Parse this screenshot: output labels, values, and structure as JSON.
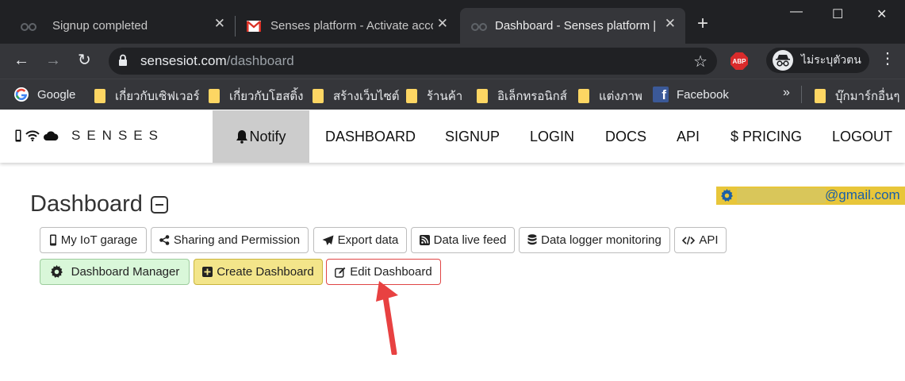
{
  "browser": {
    "tabs": [
      {
        "title": "Signup completed",
        "close": "✕"
      },
      {
        "title": "Senses platform - Activate acco",
        "close": "✕"
      },
      {
        "title": "Dashboard - Senses platform |",
        "close": "✕"
      }
    ],
    "new_tab": "+",
    "window_controls": {
      "minimize": "—",
      "maximize": "☐",
      "close": "✕"
    },
    "nav": {
      "back": "←",
      "forward": "→",
      "reload": "↻"
    },
    "url_host": "sensesiot.com",
    "url_path": "/dashboard",
    "bookmark_star": "☆",
    "abp_label": "ABP",
    "profile_label": "ไม่ระบุตัวตน",
    "menu": "⋮",
    "bookmarks": [
      {
        "label": "Google",
        "icon": "google-icon"
      },
      {
        "label": "เกี่ยวกับเซิฟเวอร์",
        "icon": "folder-icon"
      },
      {
        "label": "เกี่ยวกับโฮสติ้ง",
        "icon": "folder-icon"
      },
      {
        "label": "สร้างเว็บไซต์",
        "icon": "folder-icon"
      },
      {
        "label": "ร้านค้า",
        "icon": "folder-icon"
      },
      {
        "label": "อิเล็กทรอนิกส์",
        "icon": "folder-icon"
      },
      {
        "label": "แต่งภาพ",
        "icon": "folder-icon"
      },
      {
        "label": "Facebook",
        "icon": "facebook-icon"
      }
    ],
    "bookmarks_more": "»",
    "other_bookmarks": "บุ๊กมาร์กอื่นๆ"
  },
  "site": {
    "brand": "SENSES",
    "nav": {
      "notify": "Notify",
      "dashboard": "DASHBOARD",
      "signup": "SIGNUP",
      "login": "LOGIN",
      "docs": "DOCS",
      "api": "API",
      "pricing": "$ PRICING",
      "logout": "LOGOUT"
    },
    "user_email_suffix": "@gmail.com",
    "page_title": "Dashboard",
    "buttons": {
      "garage": "My IoT garage",
      "sharing": "Sharing and Permission",
      "export": "Export data",
      "live_feed": "Data live feed",
      "logger": "Data logger monitoring",
      "api": "API",
      "manager": "Dashboard Manager",
      "create": "Create Dashboard",
      "edit": "Edit Dashboard"
    }
  },
  "colors": {
    "notify_bg": "#cccccc",
    "manager_bg": "#d9f7d9",
    "create_bg": "#f3e58a",
    "edit_border": "#e04545",
    "user_badge_bg": "#e8c63a",
    "arrow": "#e84141"
  }
}
